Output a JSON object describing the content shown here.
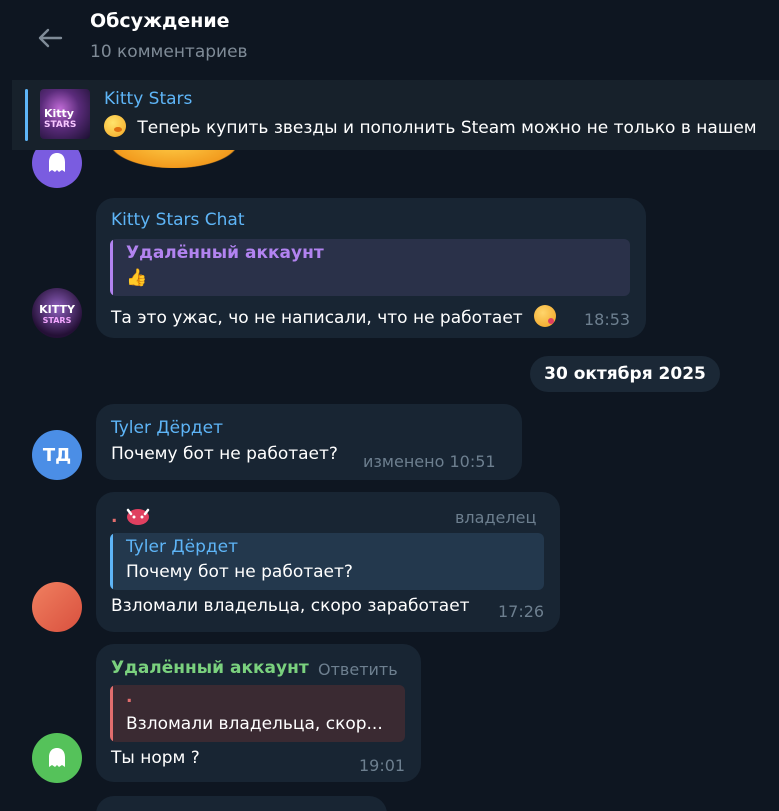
{
  "header": {
    "title": "Обсуждение",
    "subtitle": "10 комментариев"
  },
  "pinned": {
    "name": "Kitty Stars",
    "text": "Теперь купить звезды и пополнить Steam можно не только в нашем",
    "thumb_line1": "Kitty",
    "thumb_line2": "STARS"
  },
  "messages": [
    {
      "author": "Kitty Stars Chat",
      "reply_author": "Удалённый аккаунт",
      "reply_text": "👍",
      "text": "Та это ужас, чо не написали, что не работает",
      "time": "18:53",
      "avatar_line1": "KITTY",
      "avatar_line2": "STARS"
    },
    {
      "date": "30 октября 2025"
    },
    {
      "author": "Tyler Дёрдет",
      "avatar_initials": "ТД",
      "text": "Почему бот не работает?",
      "time": "изменено 10:51"
    },
    {
      "author": ".",
      "badge": "владелец",
      "reply_author": "Tyler Дёрдет",
      "reply_text": "Почему бот не работает?",
      "text": "Взломали владельца, скоро заработает",
      "time": "17:26"
    },
    {
      "author": "Удалённый аккаунт",
      "action": "Ответить",
      "reply_author": ".",
      "reply_text": "Взломали владельца, скор...",
      "text": "Ты норм ?",
      "time": "19:01"
    }
  ],
  "colors": {
    "background": "#0e1621",
    "bubble": "#182533",
    "accent_blue": "#5eb5f7",
    "accent_purple": "#b283f0",
    "accent_green": "#7ad17e",
    "accent_red": "#e26d6d"
  }
}
